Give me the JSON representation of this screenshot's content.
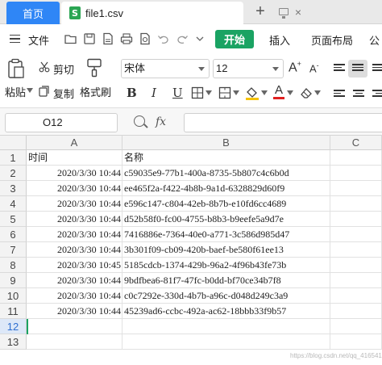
{
  "tabs": {
    "home_label": "首页",
    "file_name": "file1.csv",
    "file_icon_letter": "S",
    "close_glyph": "×",
    "new_tab_glyph": "+"
  },
  "menu": {
    "file_label": "文件",
    "start_label": "开始",
    "insert_label": "插入",
    "layout_label": "页面布局",
    "formula_label_partial": "公"
  },
  "ribbon": {
    "cut_label": "剪切",
    "paste_label": "粘贴",
    "copy_label": "复制",
    "format_painter_label": "格式刷",
    "font_name": "宋体",
    "font_size": "12",
    "bold_glyph": "B",
    "italic_glyph": "I",
    "underline_glyph": "U",
    "font_color_glyph": "A",
    "font_color": "#e02020",
    "fill_color": "#f5c200",
    "grow_glyph": "A",
    "shrink_glyph": "A"
  },
  "formula_bar": {
    "cell_ref": "O12",
    "fx_label": "fx",
    "formula_value": ""
  },
  "sheet": {
    "columns": [
      "A",
      "B",
      "C"
    ],
    "row_numbers": [
      "1",
      "2",
      "3",
      "4",
      "5",
      "6",
      "7",
      "8",
      "9",
      "10",
      "11",
      "12",
      "13"
    ],
    "header_row": [
      "时间",
      "名称"
    ],
    "rows": [
      [
        "2020/3/30 10:44",
        "c59035e9-77b1-400a-8735-5b807c4c6b0d"
      ],
      [
        "2020/3/30 10:44",
        "ee465f2a-f422-4b8b-9a1d-6328829d60f9"
      ],
      [
        "2020/3/30 10:44",
        "e596c147-c804-42eb-8b7b-e10fd6cc4689"
      ],
      [
        "2020/3/30 10:44",
        "d52b58f0-fc00-4755-b8b3-b9eefe5a9d7e"
      ],
      [
        "2020/3/30 10:44",
        "7416886e-7364-40e0-a771-3c586d985d47"
      ],
      [
        "2020/3/30 10:44",
        "3b301f09-cb09-420b-baef-be580f61ee13"
      ],
      [
        "2020/3/30 10:45",
        "5185cdcb-1374-429b-96a2-4f96b43fe73b"
      ],
      [
        "2020/3/30 10:44",
        "9bdfbea6-81f7-47fc-b0dd-bf70ce34b7f8"
      ],
      [
        "2020/3/30 10:44",
        "c0c7292e-330d-4b7b-a96c-d048d249c3a9"
      ],
      [
        "2020/3/30 10:44",
        "45239ad6-ccbc-492a-ac62-18bbb33f9b57"
      ]
    ],
    "selected_row": "12",
    "accent": "#1aa363"
  },
  "watermark": "https://blog.csdn.net/qq_41654177"
}
